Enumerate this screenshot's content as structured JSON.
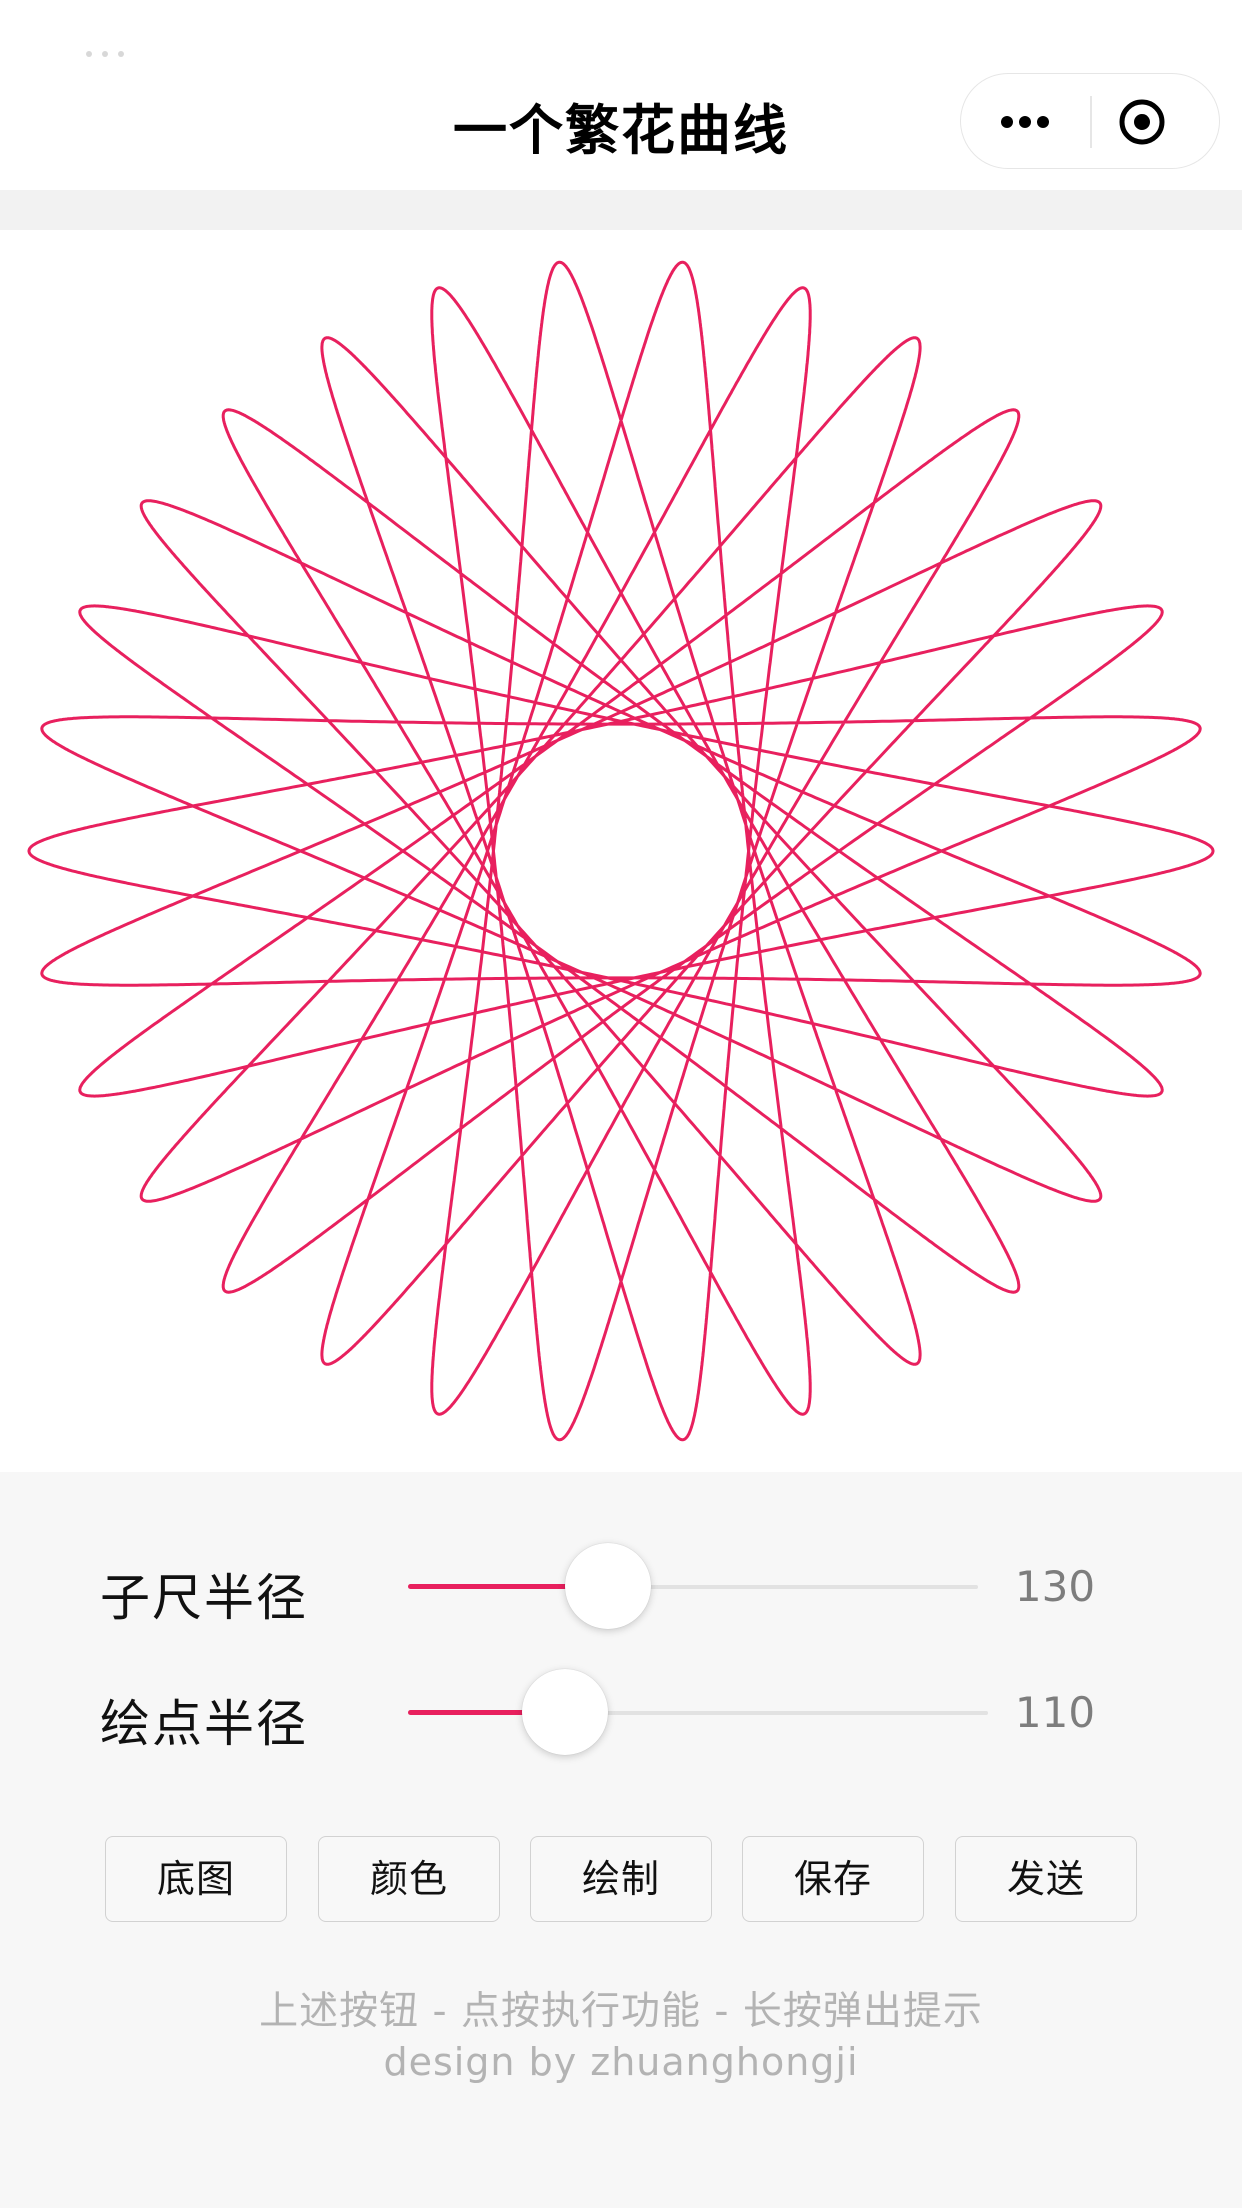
{
  "navbar": {
    "title": "一个繁花曲线",
    "more_icon": "more-dots-icon",
    "close_icon": "target-circle-icon"
  },
  "spirograph": {
    "stroke_color": "#e8205e",
    "fixed_ring_radius": 300,
    "sub_ruler_radius": 130,
    "pen_point_radius": 110
  },
  "sliders": [
    {
      "label": "子尺半径",
      "value": "130",
      "fraction": 0.35
    },
    {
      "label": "绘点半径",
      "value": "110",
      "fraction": 0.27
    }
  ],
  "buttons": [
    {
      "label": "底图"
    },
    {
      "label": "颜色"
    },
    {
      "label": "绘制"
    },
    {
      "label": "保存"
    },
    {
      "label": "发送"
    }
  ],
  "footer": {
    "tip": "上述按钮 - 点按执行功能 - 长按弹出提示",
    "credit": "design by zhuanghongji"
  },
  "colors": {
    "accent": "#e8205e",
    "background": "#f7f7f7",
    "canvas": "#ffffff"
  }
}
